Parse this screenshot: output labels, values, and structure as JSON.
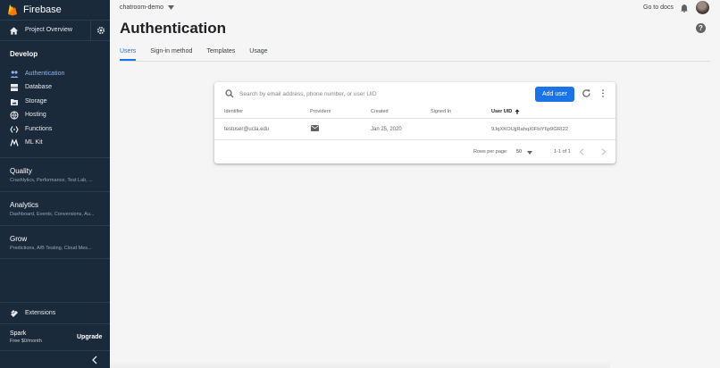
{
  "sidebar": {
    "brand": "Firebase",
    "project_overview": "Project Overview",
    "develop_title": "Develop",
    "develop_items": [
      {
        "label": "Authentication",
        "icon": "people-icon",
        "active": true
      },
      {
        "label": "Database",
        "icon": "database-icon"
      },
      {
        "label": "Storage",
        "icon": "storage-icon"
      },
      {
        "label": "Hosting",
        "icon": "hosting-icon"
      },
      {
        "label": "Functions",
        "icon": "functions-icon"
      },
      {
        "label": "ML Kit",
        "icon": "mlkit-icon"
      }
    ],
    "sections": [
      {
        "title": "Quality",
        "sub": "Crashlytics, Performance, Test Lab, ..."
      },
      {
        "title": "Analytics",
        "sub": "Dashboard, Events, Conversions, Au..."
      },
      {
        "title": "Grow",
        "sub": "Predictions, A/B Testing, Cloud Mes..."
      }
    ],
    "extensions": "Extensions",
    "plan": {
      "name": "Spark",
      "price": "Free $0/month",
      "upgrade": "Upgrade"
    }
  },
  "header": {
    "project": "chatroom-demo",
    "docs": "Go to docs",
    "title": "Authentication",
    "help": "?"
  },
  "tabs": [
    "Users",
    "Sign-in method",
    "Templates",
    "Usage"
  ],
  "users_table": {
    "search_placeholder": "Search by email address, phone number, or user UID",
    "add_user": "Add user",
    "columns": [
      "Identifier",
      "Providers",
      "Created",
      "Signed In",
      "User UID"
    ],
    "rows": [
      {
        "identifier": "testuser@ucla.edu",
        "provider_icon": "mail-icon",
        "created": "Jan 25, 2020",
        "signed_in": "",
        "uid": "9JqXKOUjjRahqXIFbiY6p9GRI22"
      }
    ],
    "rows_per_page_label": "Rows per page:",
    "rows_per_page": "50",
    "range": "1-1 of 1"
  },
  "colors": {
    "accent": "#1a73e8",
    "sidebar": "#1b2a3a",
    "brand": "#ffa000"
  }
}
